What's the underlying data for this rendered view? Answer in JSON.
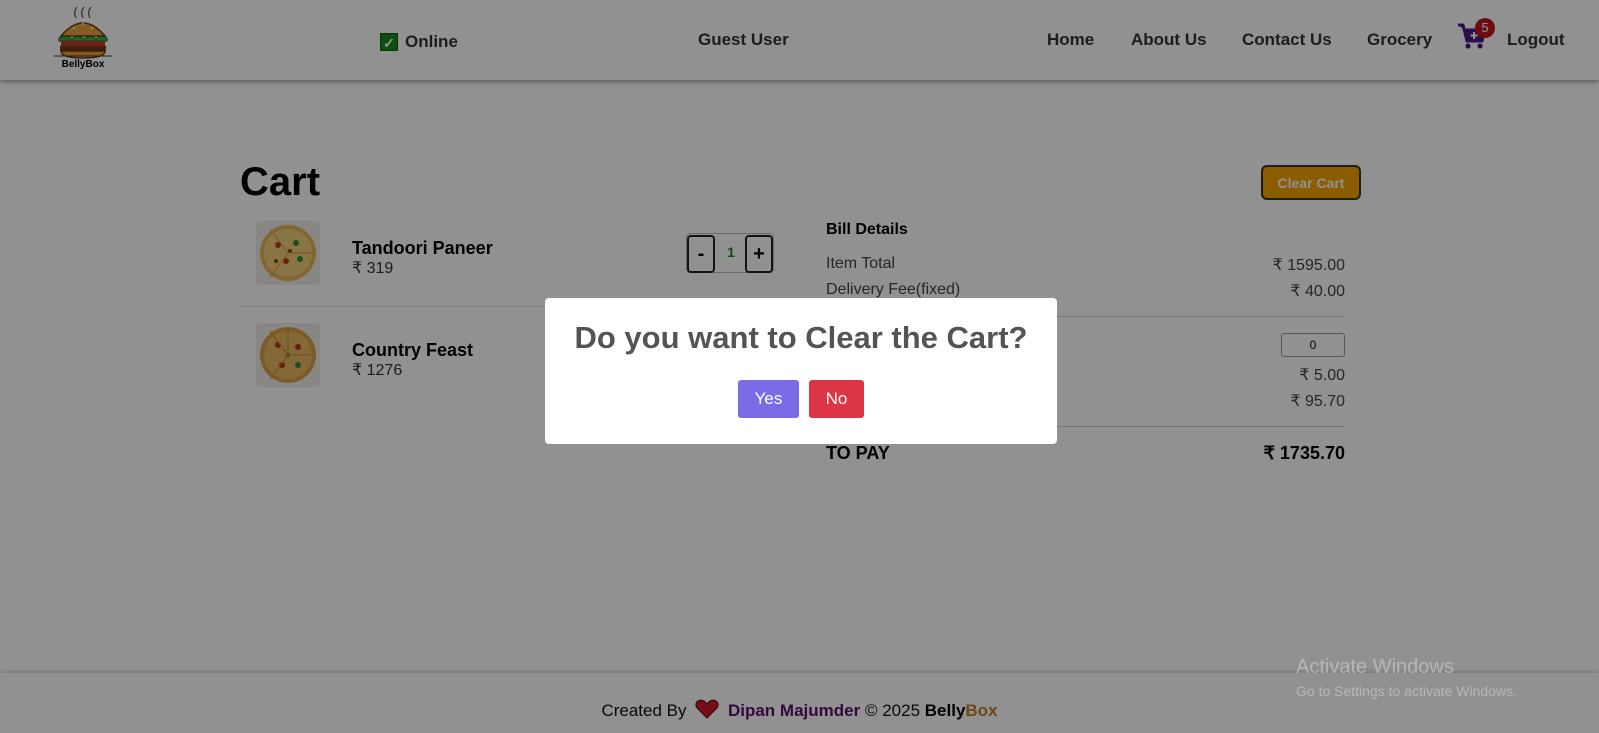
{
  "header": {
    "logo_text": "BellyBox",
    "online_label": "Online",
    "user_name": "Guest User",
    "nav": [
      "Home",
      "About Us",
      "Contact Us",
      "Grocery"
    ],
    "cart_count": "5",
    "logout_label": "Logout"
  },
  "cart": {
    "title": "Cart",
    "clear_label": "Clear Cart",
    "items": [
      {
        "name": "Tandoori Paneer",
        "price": "₹ 319",
        "quantity": "1"
      },
      {
        "name": "Country Feast",
        "price": "₹ 1276"
      }
    ]
  },
  "bill": {
    "title": "Bill Details",
    "item_total_label": "Item Total",
    "item_total_value": "₹ 1595.00",
    "delivery_label": "Delivery Fee(fixed)",
    "delivery_value": "₹ 40.00",
    "tip_value": "0",
    "row3_value": "₹ 5.00",
    "row4_value": "₹ 95.70",
    "to_pay_label": "TO PAY",
    "to_pay_value": "₹ 1735.70"
  },
  "footer": {
    "created_by": "Created By",
    "author": "Dipan Majumder",
    "copyright": "© 2025",
    "brand_a": "Belly",
    "brand_b": "Box"
  },
  "modal": {
    "question": "Do you want to Clear the Cart?",
    "yes_label": "Yes",
    "no_label": "No"
  },
  "watermark": {
    "line1": "Activate Windows",
    "line2": "Go to Settings to activate Windows."
  },
  "colors": {
    "accent_purple": "#7b6be6",
    "danger_red": "#dc3545",
    "clear_orange": "#f5a300",
    "cart_icon": "#4a1a8a"
  }
}
